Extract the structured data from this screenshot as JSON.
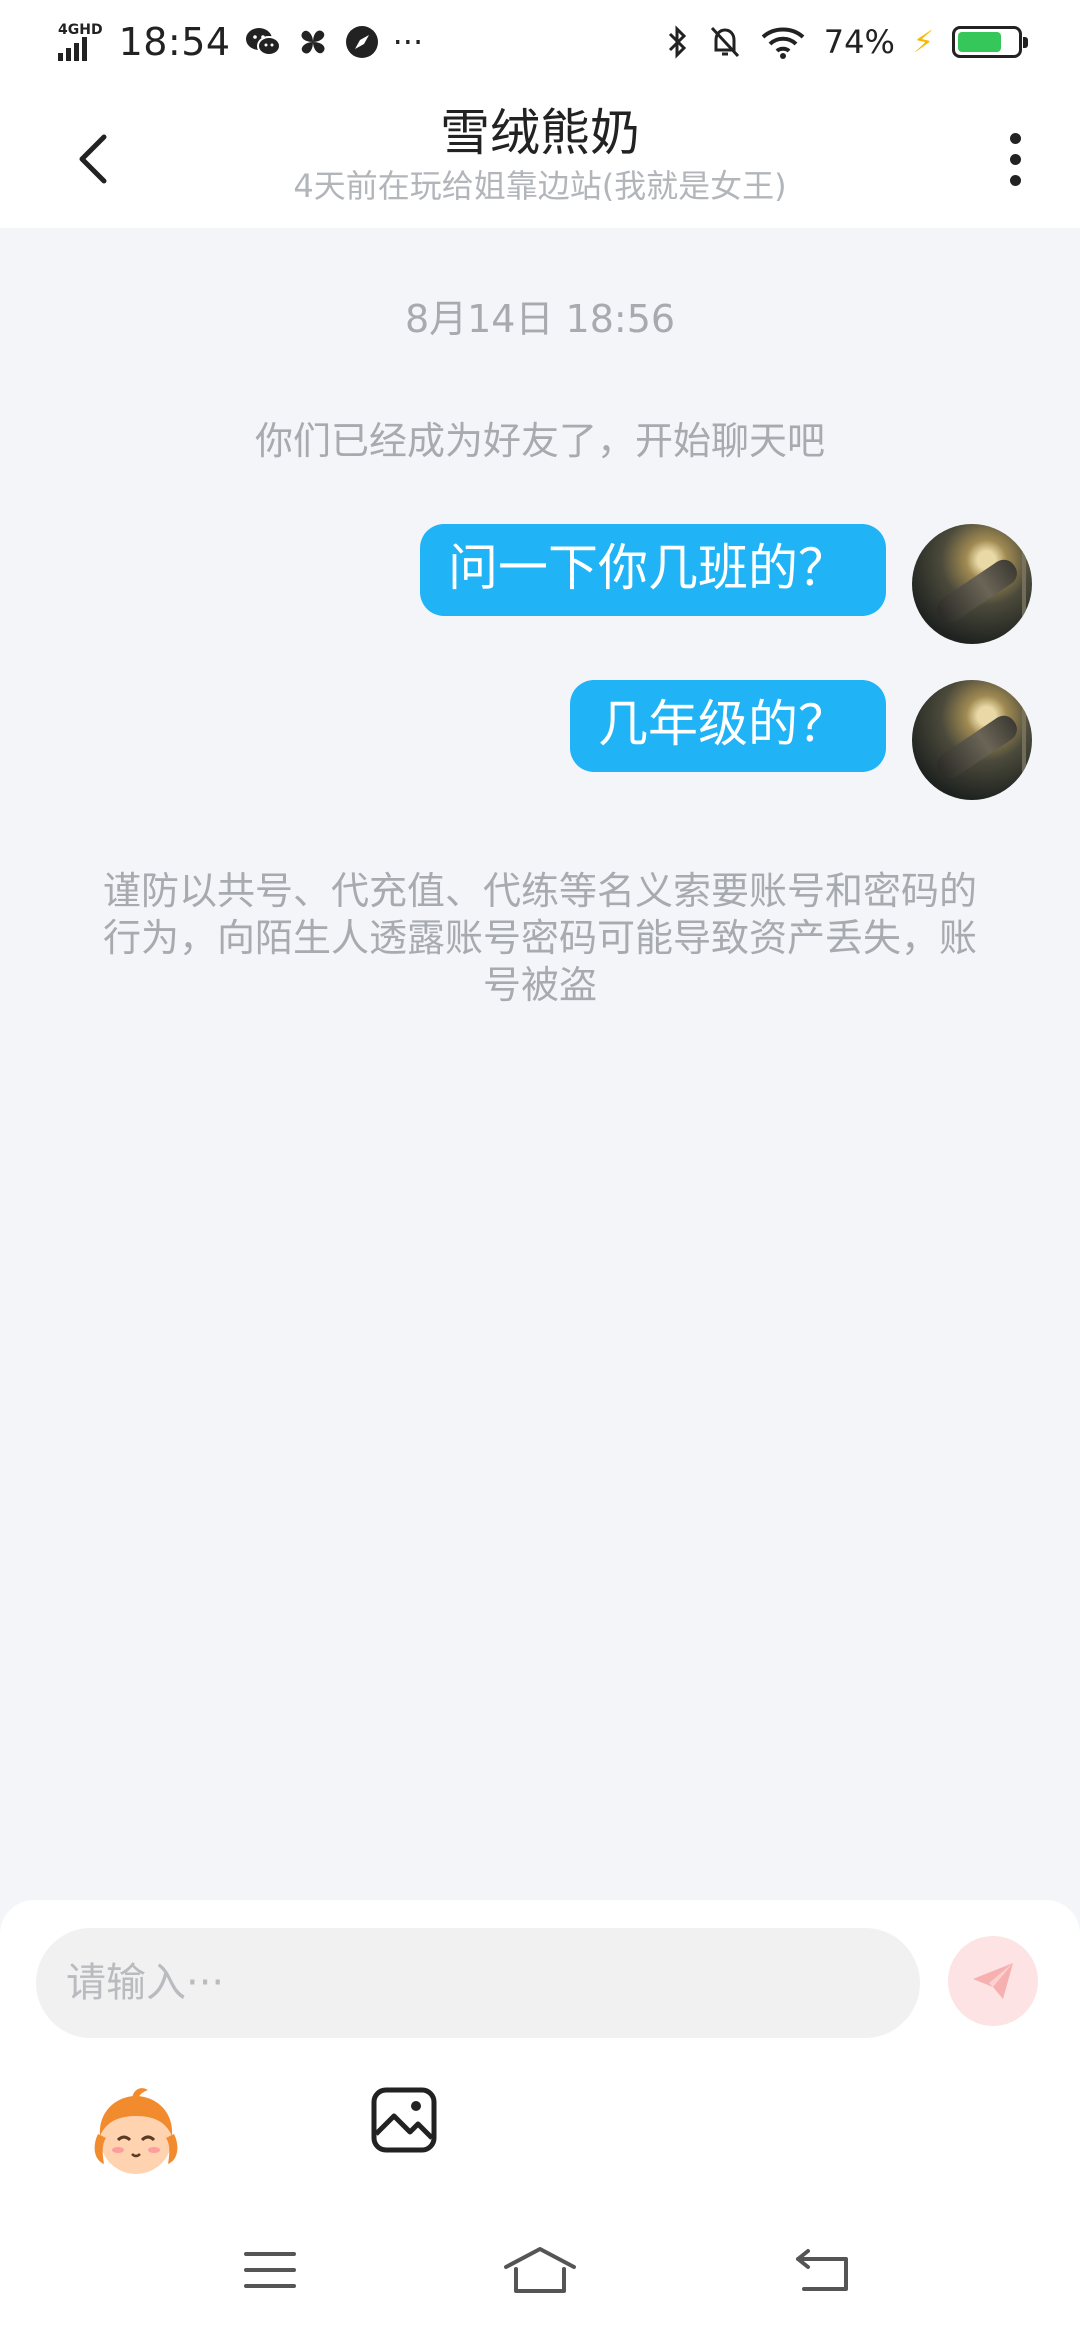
{
  "status_bar": {
    "network": "4GHD",
    "time": "18:54",
    "battery_percent": "74%",
    "battery_level": 0.74,
    "icons": [
      "wechat-icon",
      "pinwheel-icon",
      "compass-icon",
      "more-dots-icon",
      "bluetooth-icon",
      "mute-bell-icon",
      "wifi-icon",
      "charging-icon",
      "battery-icon"
    ]
  },
  "header": {
    "title": "雪绒熊奶",
    "subtitle": "4天前在玩给姐靠边站(我就是女王)"
  },
  "chat": {
    "timestamp": "8月14日 18:56",
    "system_message": "你们已经成为好友了，开始聊天吧",
    "messages": [
      {
        "text": "问一下你几班的？",
        "sender": "self"
      },
      {
        "text": "几年级的？",
        "sender": "self"
      }
    ],
    "warning": "谨防以共号、代充值、代练等名义索要账号和密码的行为，向陌生人透露账号密码可能导致资产丢失，账号被盗"
  },
  "input": {
    "placeholder": "请输入···",
    "value": ""
  },
  "colors": {
    "bubble": "#20b3f6",
    "background": "#f3f5f8",
    "send_button_disabled": "#fde3e3",
    "send_icon": "#f7b0b0"
  }
}
